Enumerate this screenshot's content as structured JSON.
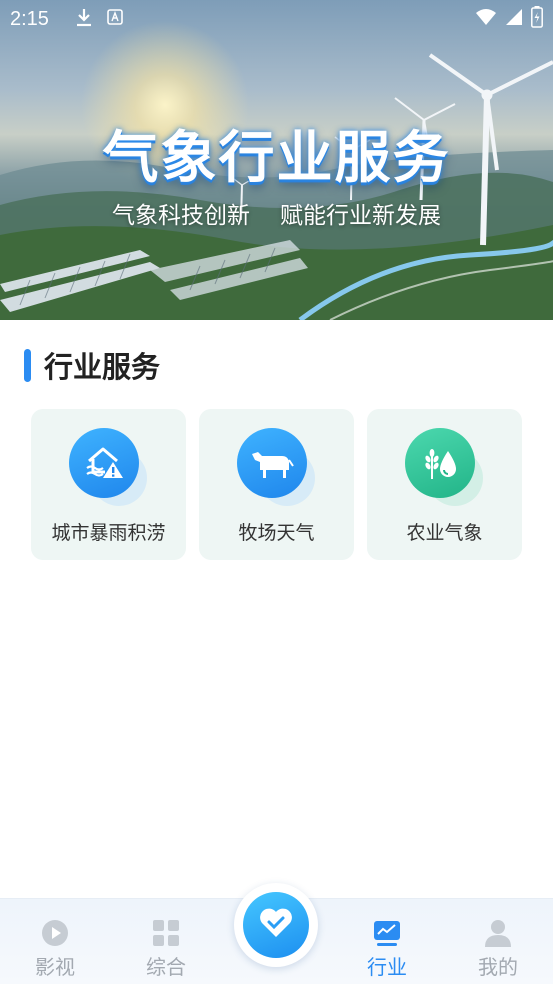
{
  "status_bar": {
    "time": "2:15",
    "left_icons": [
      "download-icon",
      "keyboard-a-icon"
    ],
    "right_icons": [
      "wifi-icon",
      "signal-icon",
      "battery-icon"
    ]
  },
  "banner": {
    "title": "气象行业服务",
    "subtitle_left": "气象科技创新",
    "subtitle_right": "赋能行业新发展"
  },
  "section": {
    "title": "行业服务",
    "accent_color": "#2b8cf2"
  },
  "services": [
    {
      "label": "城市暴雨积涝",
      "icon": "house-flood-warning-icon",
      "color": "#2b8cf2"
    },
    {
      "label": "牧场天气",
      "icon": "cow-icon",
      "color": "#2b8cf2"
    },
    {
      "label": "农业气象",
      "icon": "wheat-droplet-icon",
      "color": "#2dbf94"
    }
  ],
  "bottom_nav": {
    "items": [
      {
        "label": "影视",
        "icon": "play-circle-icon",
        "active": false
      },
      {
        "label": "综合",
        "icon": "grid-icon",
        "active": false
      },
      {
        "label": "行业",
        "icon": "chart-monitor-icon",
        "active": true
      },
      {
        "label": "我的",
        "icon": "person-icon",
        "active": false
      }
    ],
    "center_icon": "heart-icon",
    "active_color": "#2b8cf2",
    "inactive_color": "#a3a9b1"
  }
}
